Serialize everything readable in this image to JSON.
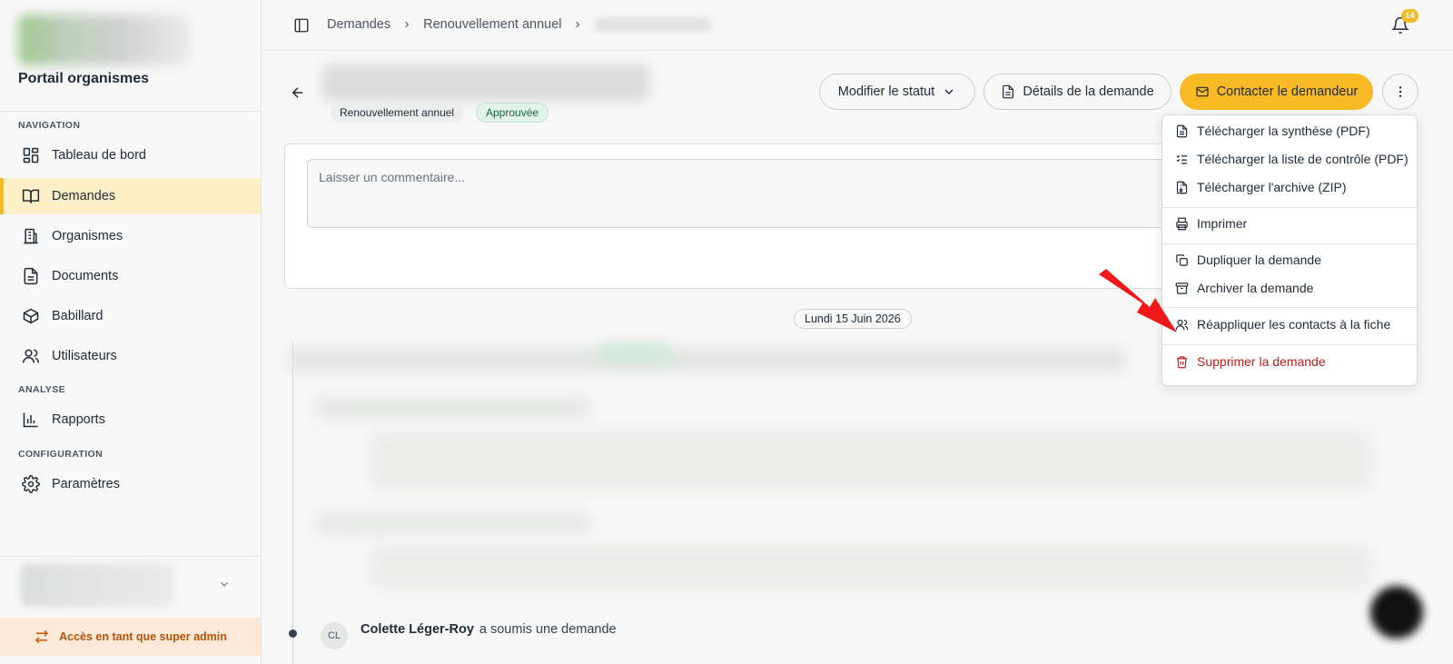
{
  "sidebar": {
    "portal_title": "Portail organismes",
    "sections": {
      "navigation": "NAVIGATION",
      "analyse": "ANALYSE",
      "configuration": "CONFIGURATION"
    },
    "items": [
      {
        "label": "Tableau de bord",
        "icon": "dashboard-icon"
      },
      {
        "label": "Demandes",
        "icon": "book-open-icon",
        "active": true
      },
      {
        "label": "Organismes",
        "icon": "building-icon"
      },
      {
        "label": "Documents",
        "icon": "document-icon"
      },
      {
        "label": "Babillard",
        "icon": "box-icon"
      },
      {
        "label": "Utilisateurs",
        "icon": "users-icon"
      },
      {
        "label": "Rapports",
        "icon": "bar-chart-icon"
      },
      {
        "label": "Paramètres",
        "icon": "gear-icon"
      }
    ],
    "superadmin_label": "Accès en tant que super admin"
  },
  "topbar": {
    "breadcrumb": [
      "Demandes",
      "Renouvellement annuel"
    ],
    "notification_count": "14"
  },
  "header": {
    "tag_type": "Renouvellement annuel",
    "tag_status": "Approuvée",
    "btn_status": "Modifier le statut",
    "btn_details": "Détails de la demande",
    "btn_contact": "Contacter le demandeur"
  },
  "comment": {
    "placeholder": "Laisser un commentaire..."
  },
  "timeline": {
    "date": "Lundi 15 Juin 2026",
    "event": {
      "initials": "CL",
      "who": "Colette Léger-Roy",
      "what": "a soumis une demande"
    }
  },
  "menu": {
    "items": [
      {
        "label": "Télécharger la synthèse (PDF)",
        "icon": "file-text-icon"
      },
      {
        "label": "Télécharger la liste de contrôle (PDF)",
        "icon": "list-checks-icon"
      },
      {
        "label": "Télécharger l'archive (ZIP)",
        "icon": "file-archive-icon"
      },
      {
        "label": "Imprimer",
        "icon": "printer-icon"
      },
      {
        "label": "Dupliquer la demande",
        "icon": "copy-icon"
      },
      {
        "label": "Archiver la demande",
        "icon": "archive-icon"
      },
      {
        "label": "Réappliquer les contacts à la fiche",
        "icon": "users-icon"
      },
      {
        "label": "Supprimer la demande",
        "icon": "trash-icon",
        "danger": true
      }
    ]
  },
  "colors": {
    "accent": "#f7b924",
    "danger": "#b91c1c",
    "annotation_arrow": "#f01818"
  }
}
